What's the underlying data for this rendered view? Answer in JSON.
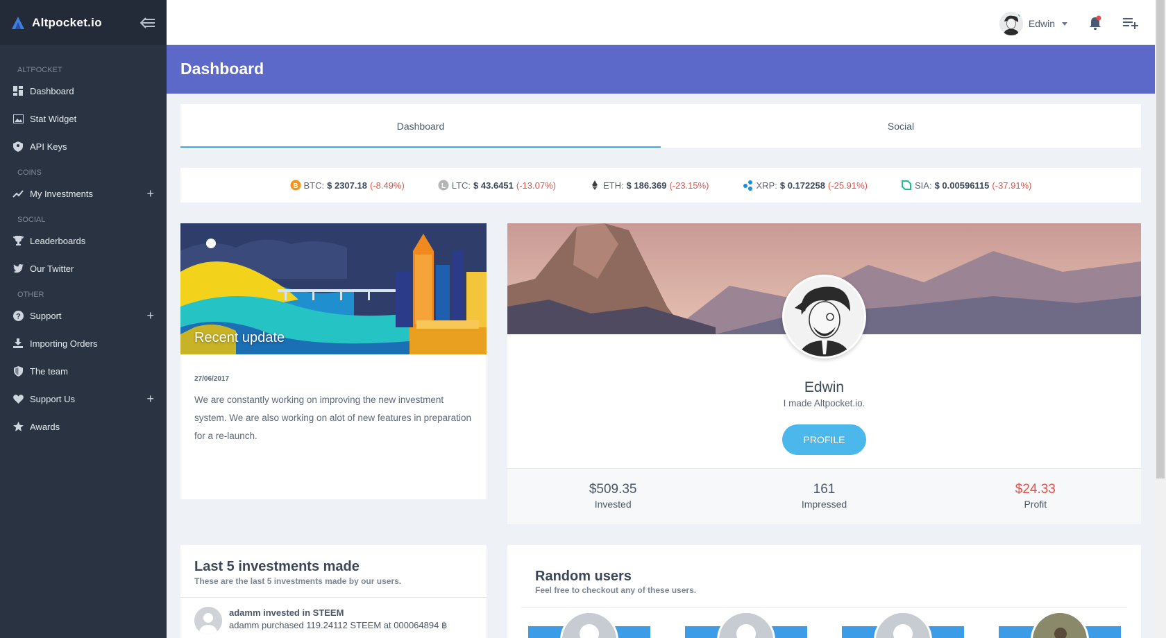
{
  "brand": {
    "name": "Altpocket.io"
  },
  "sidebar": {
    "sections": [
      {
        "title": "ALTPOCKET",
        "items": [
          {
            "label": "Dashboard",
            "icon": "dashboard-icon"
          },
          {
            "label": "Stat Widget",
            "icon": "image-icon"
          },
          {
            "label": "API Keys",
            "icon": "shield-key-icon"
          }
        ]
      },
      {
        "title": "COINS",
        "items": [
          {
            "label": "My Investments",
            "icon": "trend-icon",
            "expandable": true
          }
        ]
      },
      {
        "title": "SOCIAL",
        "items": [
          {
            "label": "Leaderboards",
            "icon": "trophy-icon"
          },
          {
            "label": "Our Twitter",
            "icon": "twitter-icon"
          }
        ]
      },
      {
        "title": "OTHER",
        "items": [
          {
            "label": "Support",
            "icon": "help-icon",
            "expandable": true
          },
          {
            "label": "Importing Orders",
            "icon": "download-icon"
          },
          {
            "label": "The team",
            "icon": "shield-icon"
          },
          {
            "label": "Support Us",
            "icon": "heart-icon",
            "expandable": true
          },
          {
            "label": "Awards",
            "icon": "star-icon"
          }
        ]
      }
    ],
    "plus": "+"
  },
  "topbar": {
    "user_name": "Edwin"
  },
  "page": {
    "title": "Dashboard"
  },
  "tabs": [
    {
      "label": "Dashboard",
      "active": true
    },
    {
      "label": "Social",
      "active": false
    }
  ],
  "ticker": [
    {
      "symbol": "BTC:",
      "price": "$ 2307.18",
      "change": "(-8.49%)",
      "color": "#f7931a"
    },
    {
      "symbol": "LTC:",
      "price": "$ 43.6451",
      "change": "(-13.07%)",
      "color": "#b5b5b5"
    },
    {
      "symbol": "ETH:",
      "price": "$ 186.369",
      "change": "(-23.15%)",
      "color": "#3c3c3d"
    },
    {
      "symbol": "XRP:",
      "price": "$ 0.172258",
      "change": "(-25.91%)",
      "color": "#1d8fd8"
    },
    {
      "symbol": "SIA:",
      "price": "$ 0.00596115",
      "change": "(-37.91%)",
      "color": "#20c28a"
    }
  ],
  "update": {
    "title": "Recent update",
    "date": "27/06/2017",
    "text": "We are constantly working on improving the new investment system. We are also working on alot of new features in preparation for a re-launch."
  },
  "profile": {
    "name": "Edwin",
    "bio": "I made Altpocket.io.",
    "button": "PROFILE",
    "stats": [
      {
        "value": "$509.35",
        "label": "Invested",
        "negative": false
      },
      {
        "value": "161",
        "label": "Impressed",
        "negative": false
      },
      {
        "value": "$24.33",
        "label": "Profit",
        "negative": true
      }
    ]
  },
  "investments": {
    "title": "Last 5 investments made",
    "subtitle": "These are the last 5 investments made by our users.",
    "rows": [
      {
        "head": "adamm invested in STEEM",
        "detail": "adamm purchased 119.24112 STEEM at 000064894 ฿"
      }
    ]
  },
  "random_users": {
    "title": "Random users",
    "subtitle": "Feel free to checkout any of these users."
  },
  "colors": {
    "accent": "#5c69c8",
    "sidebar": "#2a3342",
    "button": "#4bb7ea",
    "negative": "#e0534a"
  }
}
